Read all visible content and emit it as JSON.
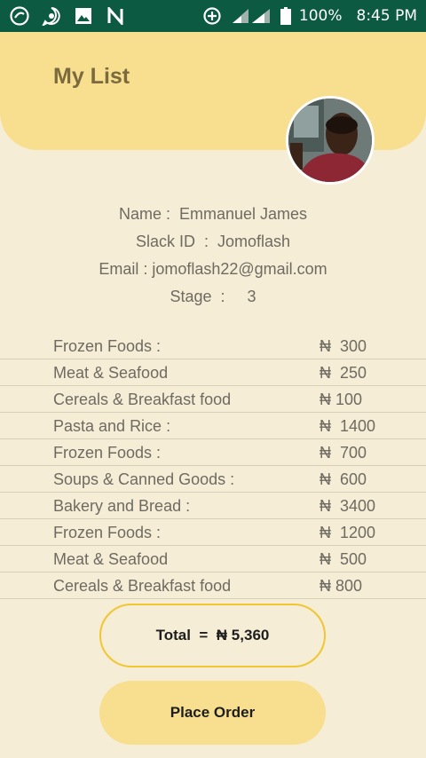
{
  "status_bar": {
    "battery": "100%",
    "time": "8:45 PM"
  },
  "header": {
    "title": "My List"
  },
  "profile": {
    "name_line": "Name :  Emmanuel James",
    "slack_line": "Slack ID  :  Jomoflash",
    "email_line": "Email : jomoflash22@gmail.com",
    "stage_line": "Stage  :     3"
  },
  "items": [
    {
      "name": "Frozen Foods :",
      "price": "₦  300"
    },
    {
      "name": "Meat & Seafood",
      "price": "₦  250"
    },
    {
      "name": "Cereals & Breakfast food",
      "price": "₦ 100"
    },
    {
      "name": "Pasta and Rice :",
      "price": "₦  1400"
    },
    {
      "name": "Frozen Foods :",
      "price": "₦  700"
    },
    {
      "name": "Soups & Canned Goods :",
      "price": "₦  600"
    },
    {
      "name": "Bakery and Bread :",
      "price": "₦  3400"
    },
    {
      "name": "Frozen Foods :",
      "price": "₦  1200"
    },
    {
      "name": "Meat & Seafood",
      "price": "₦  500"
    },
    {
      "name": "Cereals & Breakfast food",
      "price": "₦ 800"
    }
  ],
  "total": {
    "label": "Total  =  ₦ 5,360"
  },
  "place_order": {
    "label": "Place Order"
  },
  "colors": {
    "status_bar": "#0d5a43",
    "header": "#f7df8f",
    "background": "#f6edd6",
    "total_border": "#f0c632"
  },
  "icons": [
    "opera-icon",
    "whatsapp-icon",
    "gallery-icon",
    "n-app-icon",
    "data-saver-icon",
    "signal-icon",
    "battery-icon",
    "avatar-photo"
  ]
}
